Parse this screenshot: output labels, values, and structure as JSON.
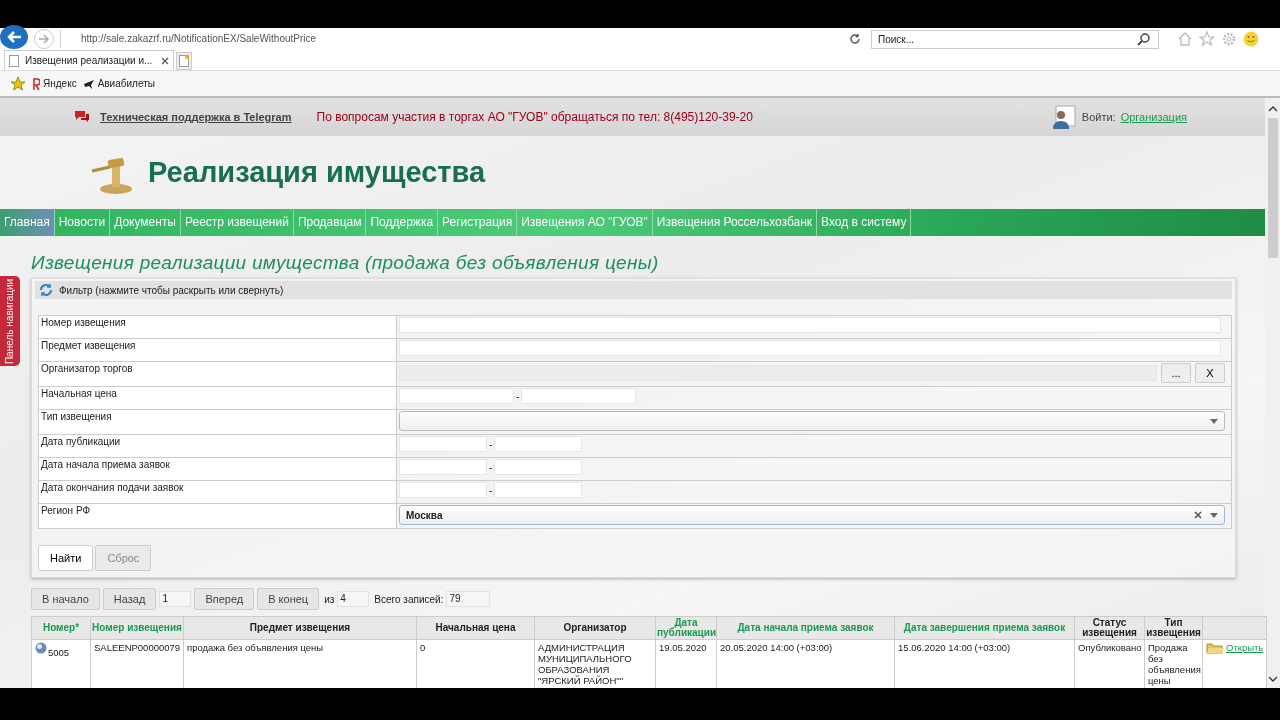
{
  "browser": {
    "url": "http://sale.zakazrf.ru/NotificationEX/SaleWithoutPrice",
    "search_placeholder": "Поиск...",
    "tab_title": "Извещения реализации и...",
    "favorites": [
      "Яндекс",
      "Авиабилеты"
    ]
  },
  "topbar": {
    "support_link": "Техническая поддержка в Telegram",
    "notice": "По вопросам участия в торгах АО \"ГУОВ\" обращаться по тел: 8(495)120-39-20",
    "login_label": "Войти:",
    "login_link": "Организация"
  },
  "site_title": "Реализация имущества",
  "nav": [
    {
      "label": "Главная",
      "selected": true
    },
    {
      "label": "Новости",
      "selected": false
    },
    {
      "label": "Документы",
      "selected": false
    },
    {
      "label": "Реестр извещений",
      "selected": false
    },
    {
      "label": "Продавцам",
      "selected": false
    },
    {
      "label": "Поддержка",
      "selected": false
    },
    {
      "label": "Регистрация",
      "selected": false
    },
    {
      "label": "Извещения АО \"ГУОВ\"",
      "selected": false
    },
    {
      "label": "Извещения Россельхозбанк",
      "selected": false
    },
    {
      "label": "Вход в систему",
      "selected": false
    }
  ],
  "side_tab": "Панель навигации",
  "page_title": "Извещения реализации имущества (продажа без объявления цены)",
  "filter": {
    "header": "Фильтр (нажмите чтобы раскрыть или свернуть)",
    "fields": [
      {
        "label": "Номер извещения",
        "kind": "text"
      },
      {
        "label": "Предмет извещения",
        "kind": "text"
      },
      {
        "label": "Организатор торгов",
        "kind": "lookup",
        "buttons": [
          "...",
          "X"
        ]
      },
      {
        "label": "Начальная цена",
        "kind": "price_range",
        "separator": "-"
      },
      {
        "label": "Тип извещения",
        "kind": "select"
      },
      {
        "label": "Дата публикации",
        "kind": "date_range",
        "separator": "-"
      },
      {
        "label": "Дата начала приема заявок",
        "kind": "date_range",
        "separator": "-"
      },
      {
        "label": "Дата окончания подачи заявок",
        "kind": "date_range",
        "separator": "-"
      },
      {
        "label": "Регион РФ",
        "kind": "select",
        "value": "Москва"
      }
    ],
    "find_button": "Найти",
    "reset_button": "Сброс"
  },
  "pager": {
    "first": "В начало",
    "prev": "Назад",
    "page": "1",
    "next": "Вперед",
    "last": "В конец",
    "of_label": "из",
    "total_pages": "4",
    "total_label": "Всего записей:",
    "total": "79"
  },
  "table": {
    "columns": [
      {
        "label": "Номер*",
        "link": true
      },
      {
        "label": "Номер извещения",
        "link": true
      },
      {
        "label": "Предмет извещения",
        "link": false
      },
      {
        "label": "Начальная цена",
        "link": false
      },
      {
        "label": "Организатор",
        "link": false
      },
      {
        "label": "Дата публикации",
        "link": true
      },
      {
        "label": "Дата начала приема заявок",
        "link": true
      },
      {
        "label": "Дата завершения приема заявок",
        "link": true
      },
      {
        "label": "Статус извещения",
        "link": false
      },
      {
        "label": "Тип извещения",
        "link": false
      }
    ],
    "rows": [
      {
        "cells": [
          "5005",
          "SALEENP00000079",
          "продажа без объявления цены",
          "0",
          "АДМИНИСТРАЦИЯ МУНИЦИПАЛЬНОГО ОБРАЗОВАНИЯ \"ЯРСКИЙ РАЙОН\"\"",
          "19.05.2020",
          "20.05.2020 14:00 (+03:00)",
          "15.06.2020 14:00 (+03:00)",
          "Опубликовано",
          "Продажа без объявления цены"
        ],
        "action": "Открыть"
      }
    ]
  }
}
